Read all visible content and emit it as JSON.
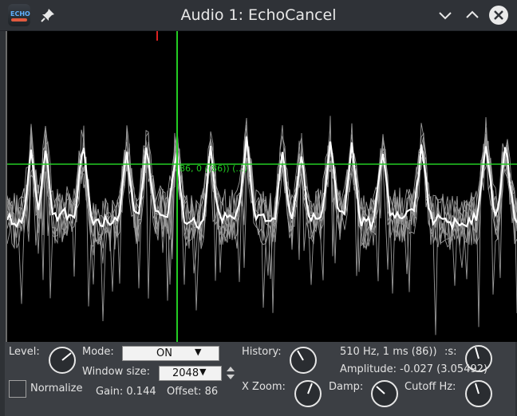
{
  "window": {
    "title": "Audio 1: EchoCancel",
    "app_icon_text": "ECHO"
  },
  "titlebar_buttons": {
    "pin": "pin-icon",
    "minimize": "chevron-down-icon",
    "maximize": "chevron-up-icon",
    "close": "close-icon"
  },
  "plot": {
    "cursor_readout": "86, 0 ((86)) (...)",
    "colors": {
      "background": "#000000",
      "trace_main": "#ffffff",
      "trace_history": "#9a9a9a",
      "crosshair": "#22cc22",
      "marker": "#dd2222"
    }
  },
  "controls": {
    "level_label": "Level:",
    "mode_label": "Mode:",
    "mode_value": "ON",
    "window_size_label": "Window size:",
    "window_size_value": "2048",
    "normalize_label": "Normalize",
    "gain_text": "Gain: 0.144",
    "offset_text": "Offset: 86",
    "history_label": "History:",
    "xzoom_label": "X Zoom:",
    "damp_label": "Damp:",
    "cutoff_label": "Cutoff Hz:",
    "info_line": "510 Hz, 1 ms (86))",
    "info_suffix": ":s:",
    "amplitude_text": "Amplitude: -0.027 (3.05492)"
  }
}
